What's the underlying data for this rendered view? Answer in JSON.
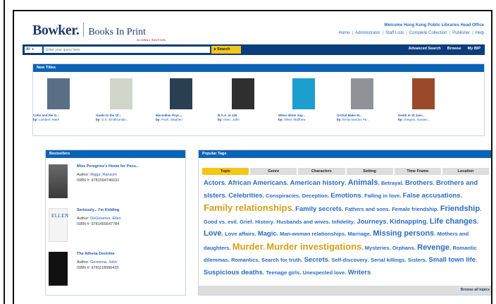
{
  "header": {
    "logo_brand": "Bowker.",
    "logo_product": "Books In Print",
    "logo_edition": "GLOBAL EDITION",
    "welcome": "Welcome Hong Kong Public Libraries Head Office",
    "links": [
      "Home",
      "Administrator",
      "Staff Lists",
      "Complete Collection",
      "Publisher",
      "Help"
    ]
  },
  "search": {
    "scope": "All",
    "placeholder": "Enter your query here",
    "button": "Search",
    "links": [
      "Advanced Search",
      "Browse",
      "My BIP"
    ]
  },
  "new_titles": {
    "heading": "New Titles",
    "books": [
      {
        "title": "Colin and the G...",
        "by": "by:",
        "author": "Lambert, Mark",
        "color": "#5a6f86"
      },
      {
        "title": "Guide to the Of...",
        "by": "by:",
        "author": "U.S. Smithsonian...",
        "color": "#cfd6c9"
      },
      {
        "title": "Macmillan Psyc...",
        "by": "by:",
        "author": "Pooh, Stephen",
        "color": "#2b3f52"
      },
      {
        "title": "B.A.A. at 125",
        "by": "by:",
        "author": "Hanc, John",
        "color": "#2f2f2f"
      },
      {
        "title": "When Idiots Say...",
        "by": "by:",
        "author": "Silver, Matthew",
        "color": "#1c9fcf"
      },
      {
        "title": "Orchid Make M...",
        "by": "by:",
        "author": "Emily Sandoz Pa...",
        "color": "#8f9398"
      },
      {
        "title": "Death in St Jam...",
        "by": "by:",
        "author": "Gregory, Susann...",
        "color": "#9a4a2a"
      }
    ]
  },
  "bestsellers": {
    "heading": "Bestsellers",
    "items": [
      {
        "title": "Miss Peregrine's Home for Pecu...",
        "author_label": "Author:",
        "author": "Riggs, Ransom",
        "isbn_label": "ISBN #:",
        "isbn": "9781594746031"
      },
      {
        "title": "Seriously... I'm Kidding",
        "author_label": "Author:",
        "author": "DeGeneres, Ellen",
        "isbn_label": "ISBN #:",
        "isbn": "9781455547784"
      },
      {
        "title": "The Athena Doctrine",
        "author_label": "Author:",
        "author": "Gerzema, John",
        "isbn_label": "ISBN #:",
        "isbn": "9781118586425"
      }
    ]
  },
  "popular_tags": {
    "heading": "Popular Tags",
    "tabs": [
      "Topic",
      "Genre",
      "Characters",
      "Setting",
      "Time Frame",
      "Location"
    ],
    "active_tab": "Topic",
    "cloud": [
      {
        "text": "Actors",
        "size": 2
      },
      {
        "text": "African Americans",
        "size": 2
      },
      {
        "text": "American history",
        "size": 2
      },
      {
        "text": "Animals",
        "size": 3
      },
      {
        "text": "Betrayal",
        "size": 1
      },
      {
        "text": "Brothers",
        "size": 2
      },
      {
        "text": "Brothers and sisters",
        "size": 2
      },
      {
        "text": "Celebrities",
        "size": 2
      },
      {
        "text": "Conspiracies",
        "size": 1
      },
      {
        "text": "Deception",
        "size": 1
      },
      {
        "text": "Emotions",
        "size": 2
      },
      {
        "text": "Falling in love",
        "size": 1
      },
      {
        "text": "False accusations",
        "size": 2
      },
      {
        "text": "Family relationships",
        "size": 4
      },
      {
        "text": "Family secrets",
        "size": 2
      },
      {
        "text": "Fathers and sons",
        "size": 1
      },
      {
        "text": "Female friendship",
        "size": 1
      },
      {
        "text": "Friendship",
        "size": 3
      },
      {
        "text": "Good vs. evil",
        "size": 1
      },
      {
        "text": "Grief",
        "size": 1
      },
      {
        "text": "History",
        "size": 1
      },
      {
        "text": "Husbands and wives",
        "size": 1
      },
      {
        "text": "Infidelity",
        "size": 1
      },
      {
        "text": "Journeys",
        "size": 2
      },
      {
        "text": "Kidnapping",
        "size": 2
      },
      {
        "text": "Life changes",
        "size": 3
      },
      {
        "text": "Love",
        "size": 3
      },
      {
        "text": "Love affairs",
        "size": 1
      },
      {
        "text": "Magic",
        "size": 2
      },
      {
        "text": "Man-woman relationships",
        "size": 1
      },
      {
        "text": "Marriage",
        "size": 1
      },
      {
        "text": "Missing persons",
        "size": 3
      },
      {
        "text": "Mothers and daughters",
        "size": 1
      },
      {
        "text": "Murder",
        "size": 4
      },
      {
        "text": "Murder investigations",
        "size": 4
      },
      {
        "text": "Mysteries",
        "size": 1
      },
      {
        "text": "Orphans",
        "size": 1
      },
      {
        "text": "Revenge",
        "size": 3
      },
      {
        "text": "Romantic dilemmas",
        "size": 1
      },
      {
        "text": "Romantics",
        "size": 1
      },
      {
        "text": "Search for truth",
        "size": 1
      },
      {
        "text": "Secrets",
        "size": 2
      },
      {
        "text": "Self-discovery",
        "size": 1
      },
      {
        "text": "Serial killings",
        "size": 1
      },
      {
        "text": "Sisters",
        "size": 1
      },
      {
        "text": "Small town life",
        "size": 2
      },
      {
        "text": "Suspicious deaths",
        "size": 2
      },
      {
        "text": "Teenage girls",
        "size": 1
      },
      {
        "text": "Unexpected love",
        "size": 1
      },
      {
        "text": "Writers",
        "size": 2
      }
    ],
    "browse_all": "Browse all topics"
  },
  "colors": {
    "nav": "#0a3d7a",
    "panel_head": "#0b63b6",
    "accent": "#f5c518",
    "link": "#2a6cc0",
    "tag_big": "#d4a017"
  }
}
